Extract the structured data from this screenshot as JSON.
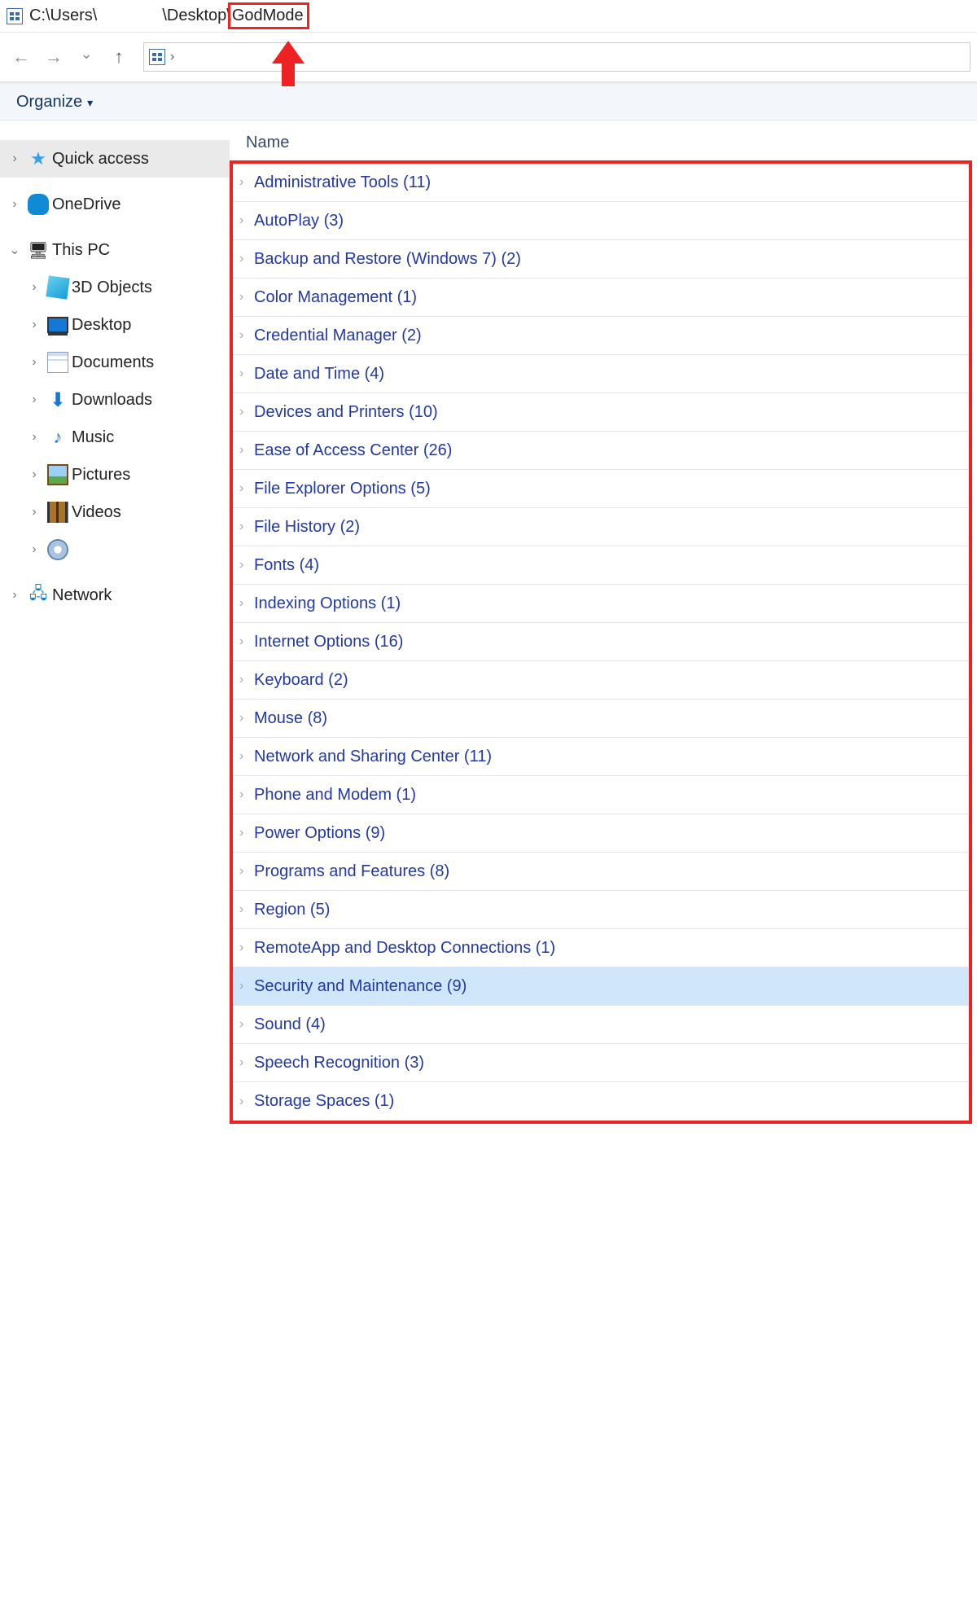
{
  "title_path": {
    "prefix": "C:\\Users\\",
    "middle": "\\Desktop\\",
    "highlight": "GodMode"
  },
  "toolbar": {
    "organize": "Organize"
  },
  "sidebar": [
    {
      "kind": "root",
      "expand": "closed",
      "icon": "star",
      "label": "Quick access",
      "selected": true
    },
    {
      "kind": "root-gap"
    },
    {
      "kind": "root",
      "expand": "closed",
      "icon": "onedrive",
      "label": "OneDrive"
    },
    {
      "kind": "root-gap"
    },
    {
      "kind": "root",
      "expand": "open",
      "icon": "pc",
      "label": "This PC"
    },
    {
      "kind": "child",
      "expand": "closed",
      "icon": "cube",
      "label": "3D Objects"
    },
    {
      "kind": "child",
      "expand": "closed",
      "icon": "monitor",
      "label": "Desktop"
    },
    {
      "kind": "child",
      "expand": "closed",
      "icon": "doc",
      "label": "Documents"
    },
    {
      "kind": "child",
      "expand": "closed",
      "icon": "down",
      "label": "Downloads"
    },
    {
      "kind": "child",
      "expand": "closed",
      "icon": "music",
      "label": "Music"
    },
    {
      "kind": "child",
      "expand": "closed",
      "icon": "pic",
      "label": "Pictures"
    },
    {
      "kind": "child",
      "expand": "closed",
      "icon": "video",
      "label": "Videos"
    },
    {
      "kind": "child",
      "expand": "closed",
      "icon": "disc",
      "label": ""
    },
    {
      "kind": "root-gap"
    },
    {
      "kind": "root",
      "expand": "closed",
      "icon": "net",
      "label": "Network"
    }
  ],
  "list_header": "Name",
  "items": [
    {
      "label": "Administrative Tools (11)"
    },
    {
      "label": "AutoPlay (3)"
    },
    {
      "label": "Backup and Restore (Windows 7) (2)"
    },
    {
      "label": "Color Management (1)"
    },
    {
      "label": "Credential Manager (2)"
    },
    {
      "label": "Date and Time (4)"
    },
    {
      "label": "Devices and Printers (10)"
    },
    {
      "label": "Ease of Access Center (26)"
    },
    {
      "label": "File Explorer Options (5)"
    },
    {
      "label": "File History (2)"
    },
    {
      "label": "Fonts (4)"
    },
    {
      "label": "Indexing Options (1)"
    },
    {
      "label": "Internet Options (16)"
    },
    {
      "label": "Keyboard (2)"
    },
    {
      "label": "Mouse (8)"
    },
    {
      "label": "Network and Sharing Center (11)"
    },
    {
      "label": "Phone and Modem (1)"
    },
    {
      "label": "Power Options (9)"
    },
    {
      "label": "Programs and Features (8)"
    },
    {
      "label": "Region (5)"
    },
    {
      "label": "RemoteApp and Desktop Connections (1)"
    },
    {
      "label": "Security and Maintenance (9)",
      "selected": true
    },
    {
      "label": "Sound (4)"
    },
    {
      "label": "Speech Recognition (3)"
    },
    {
      "label": "Storage Spaces (1)"
    }
  ]
}
